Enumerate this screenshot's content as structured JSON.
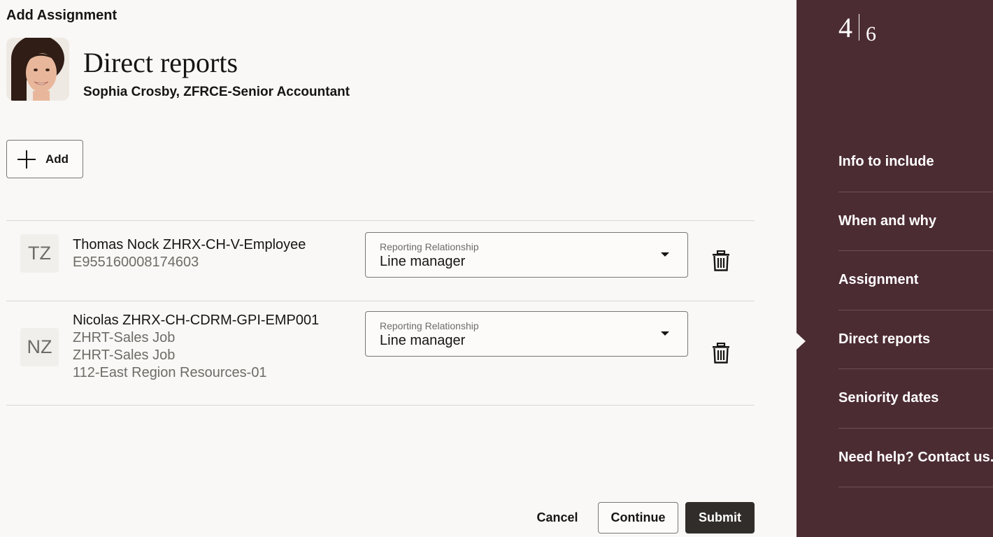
{
  "app": {
    "title": "Add Assignment"
  },
  "header": {
    "title": "Direct reports",
    "subtitle": "Sophia Crosby, ZFRCE-Senior Accountant"
  },
  "toolbar": {
    "add_label": "Add"
  },
  "reports": [
    {
      "initials": "TZ",
      "name": "Thomas Nock ZHRX-CH-V-Employee",
      "details": [
        "E955160008174603"
      ],
      "relationship_label": "Reporting Relationship",
      "relationship_value": "Line manager"
    },
    {
      "initials": "NZ",
      "name": "Nicolas ZHRX-CH-CDRM-GPI-EMP001",
      "details": [
        "ZHRT-Sales Job",
        "ZHRT-Sales Job",
        "112-East Region Resources-01"
      ],
      "relationship_label": "Reporting Relationship",
      "relationship_value": "Line manager"
    }
  ],
  "footer": {
    "cancel_label": "Cancel",
    "continue_label": "Continue",
    "submit_label": "Submit"
  },
  "progress": {
    "current": "4",
    "total": "6"
  },
  "steps": [
    {
      "label": "Info to include"
    },
    {
      "label": "When and why"
    },
    {
      "label": "Assignment"
    },
    {
      "label": "Direct reports",
      "active": true
    },
    {
      "label": "Seniority dates"
    },
    {
      "label": "Need help? Contact us."
    }
  ],
  "colors": {
    "side_panel": "#4c2c33",
    "primary_button": "#312d2a",
    "page_background": "#f9f8f6"
  }
}
